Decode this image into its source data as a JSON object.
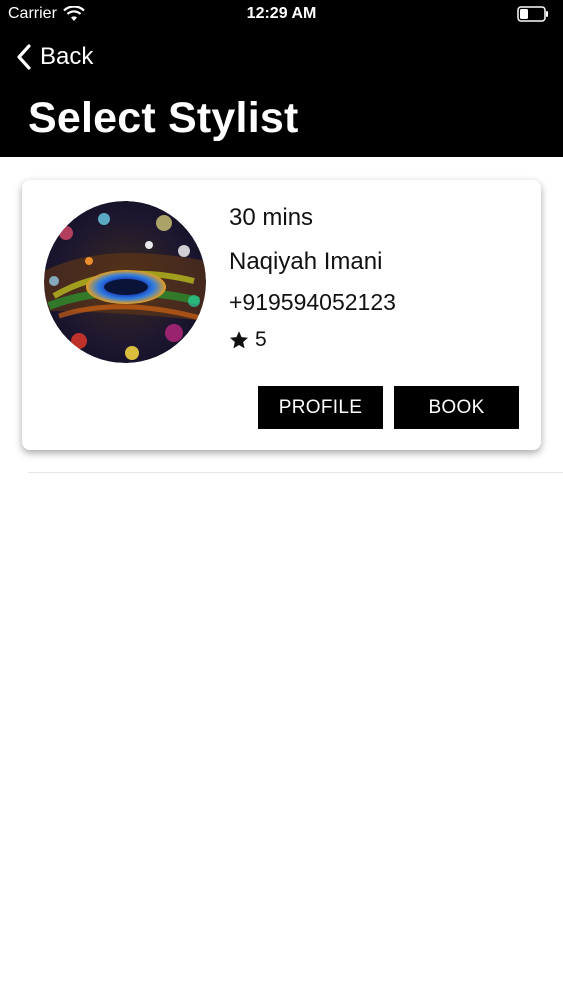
{
  "status_bar": {
    "carrier": "Carrier",
    "time": "12:29 AM"
  },
  "nav": {
    "back_label": "Back",
    "title": "Select Stylist"
  },
  "stylists": [
    {
      "duration": "30 mins",
      "name": "Naqiyah Imani",
      "phone": "+919594052123",
      "rating": "5",
      "profile_label": "PROFILE",
      "book_label": "BOOK"
    }
  ],
  "colors": {
    "header_bg": "#000000",
    "button_bg": "#000000",
    "button_text": "#ffffff"
  }
}
